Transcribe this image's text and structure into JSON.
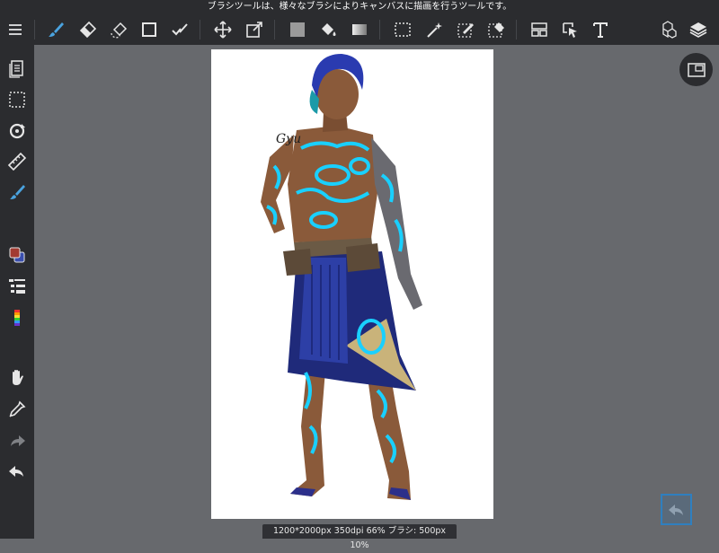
{
  "tip": {
    "text": "ブラシツールは、様々なブラシによりキャンバスに描画を行うツールです。"
  },
  "toolbar": {
    "items": [
      {
        "icon": "menu-icon"
      },
      {
        "icon": "brush-icon",
        "active": true
      },
      {
        "icon": "eraser-icon"
      },
      {
        "icon": "lasso-eraser-icon"
      },
      {
        "icon": "rectangle-shape-icon"
      },
      {
        "icon": "correction-pen-icon"
      },
      {
        "icon": "move-icon"
      },
      {
        "icon": "transform-icon"
      },
      {
        "icon": "fill-color-icon"
      },
      {
        "icon": "bucket-icon"
      },
      {
        "icon": "gradient-icon"
      },
      {
        "icon": "select-rect-icon"
      },
      {
        "icon": "magic-wand-icon"
      },
      {
        "icon": "select-pen-icon"
      },
      {
        "icon": "select-eraser-icon"
      },
      {
        "icon": "frame-divide-icon"
      },
      {
        "icon": "operation-icon"
      },
      {
        "icon": "text-icon"
      },
      {
        "icon": "material-icon"
      },
      {
        "icon": "layers-icon"
      }
    ]
  },
  "sidebar": {
    "items": [
      {
        "icon": "document-icon"
      },
      {
        "icon": "selection-icon"
      },
      {
        "icon": "snap-icon"
      },
      {
        "icon": "ruler-icon"
      },
      {
        "icon": "brush-side-icon"
      },
      {
        "icon": "color-icon"
      },
      {
        "icon": "brush-size-icon"
      },
      {
        "icon": "color-palette-icon"
      },
      {
        "icon": "hand-icon"
      },
      {
        "icon": "eyedropper-icon"
      },
      {
        "icon": "redo-icon"
      },
      {
        "icon": "undo-icon"
      }
    ]
  },
  "status": {
    "text": "1200*2000px 350dpi 66% ブラシ: 500px 10%"
  },
  "canvas": {
    "signature_text": "Gyu"
  },
  "colors": {
    "accent": "#4aa3df",
    "bar": "#2b2c2f",
    "bg": "#67696d",
    "main_color": "#a23b31",
    "sub_color": "#3b4fae"
  }
}
